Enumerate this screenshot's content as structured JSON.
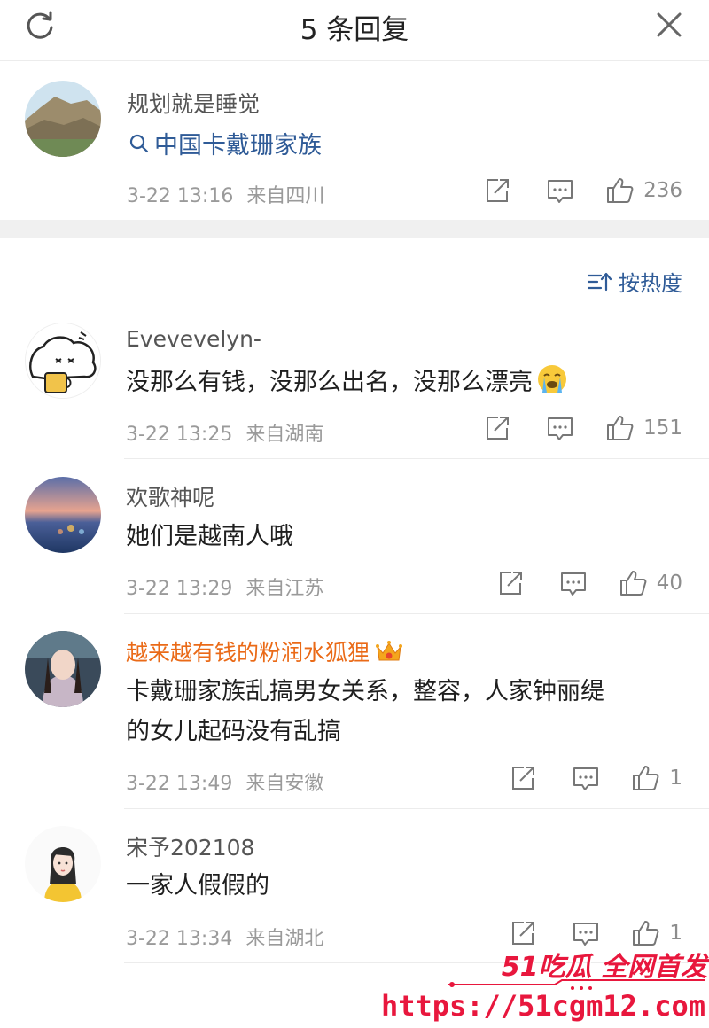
{
  "header": {
    "title": "5 条回复",
    "refresh_icon": "refresh-icon",
    "close_icon": "close-icon"
  },
  "root_comment": {
    "username": "规划就是睡觉",
    "topic": "中国卡戴珊家族",
    "time": "3-22 13:16",
    "location": "来自四川",
    "likes": "236"
  },
  "sort": {
    "label": "按热度"
  },
  "replies": [
    {
      "username": "Evevevelyn-",
      "content": "没那么有钱，没那么出名，没那么漂亮",
      "emoji": "crying-face-emoji",
      "time": "3-22 13:25",
      "location": "来自湖南",
      "likes": "151"
    },
    {
      "username": "欢歌神呢",
      "content": "她们是越南人哦",
      "time": "3-22 13:29",
      "location": "来自江苏",
      "likes": "40"
    },
    {
      "username": "越来越有钱的粉润水狐狸",
      "badge": "crown-badge-icon",
      "content_line1": "卡戴珊家族乱搞男女关系，整容，人家钟丽缇",
      "content_line2": "的女儿起码没有乱搞",
      "time": "3-22 13:49",
      "location": "来自安徽",
      "likes": "1"
    },
    {
      "username": "宋予202108",
      "content": "一家人假假的",
      "time": "3-22 13:34",
      "location": "来自湖北",
      "likes": "1"
    }
  ],
  "watermark": {
    "line1": "51吃瓜 全网首发",
    "line2": "https://51cgm12.com"
  },
  "colors": {
    "link": "#2f5b97",
    "vip_name": "#ea6a17",
    "meta": "#9a9a9a",
    "watermark": "#e8173d"
  }
}
